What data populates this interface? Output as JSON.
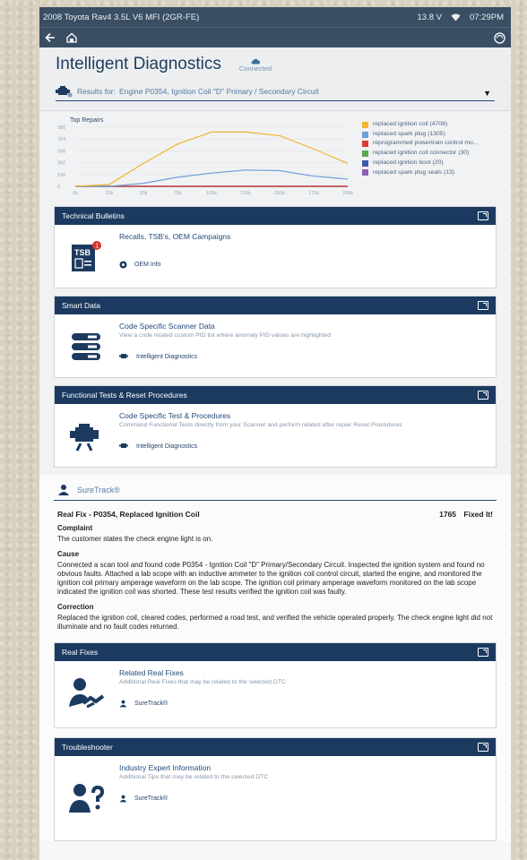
{
  "statusbar": {
    "vehicle": "2008 Toyota Rav4 3.5L V6 MFI (2GR-FE)",
    "voltage": "13.8 V",
    "time": "07:29PM"
  },
  "header": {
    "title": "Intelligent Diagnostics",
    "connection": "Connected",
    "results_prefix": "Results for:",
    "results_value": "Engine P0354, Ignition Coil \"D\" Primary / Secondary Circuit"
  },
  "chart_data": {
    "type": "line",
    "title": "Top Repairs",
    "x": [
      "0k",
      "25k",
      "50k",
      "75k",
      "100k",
      "125k",
      "150k",
      "175k",
      "200k"
    ],
    "y_ticks": [
      "980",
      "784",
      "588",
      "392",
      "196",
      "0"
    ],
    "ylim": [
      0,
      980
    ],
    "series": [
      {
        "name": "replaced ignition coil (4708)",
        "color": "#f2b431",
        "values": [
          0,
          30,
          380,
          700,
          900,
          900,
          840,
          620,
          380
        ]
      },
      {
        "name": "replaced spark plug (1305)",
        "color": "#6f9fd8",
        "values": [
          0,
          0,
          50,
          150,
          220,
          270,
          260,
          170,
          120
        ]
      },
      {
        "name": "reprogrammed powertrain control mo...",
        "color": "#d93a34",
        "values": [
          0,
          0,
          0,
          0,
          0,
          0,
          0,
          0,
          0
        ]
      },
      {
        "name": "replaced ignition coil connector (30)",
        "color": "#5aa651",
        "values": [
          0,
          0,
          0,
          0,
          0,
          0,
          0,
          0,
          0
        ]
      },
      {
        "name": "replaced ignition boot (20)",
        "color": "#3d57b0",
        "values": [
          0,
          0,
          0,
          0,
          0,
          0,
          0,
          0,
          0
        ]
      },
      {
        "name": "replaced spark plug seals (13)",
        "color": "#8e5fb4",
        "values": [
          0,
          0,
          0,
          0,
          0,
          0,
          0,
          0,
          0
        ]
      }
    ]
  },
  "bulletins": {
    "head": "Technical Bulletins",
    "badge": "1",
    "tsb": "TSB",
    "title": "Recalls, TSB's, OEM Campaigns",
    "link": "OEM Info"
  },
  "smart_data": {
    "head": "Smart Data",
    "title": "Code Specific Scanner Data",
    "desc": "View a code related custom PID list where anomaly PID values are highlighted",
    "link": "Intelligent Diagnostics"
  },
  "functional": {
    "head": "Functional Tests & Reset Procedures",
    "title": "Code Specific Test & Procedures",
    "desc": "Command Functional Tests directly from your Scanner and perform related after repair Reset Procedures",
    "link": "Intelligent Diagnostics"
  },
  "suretrack": {
    "label": "SureTrack®",
    "fix_title": "Real Fix - P0354, Replaced Ignition Coil",
    "fixed_count": "1765",
    "fixed_label": "Fixed It!",
    "complaint_h": "Complaint",
    "complaint": "The customer states the check engine light is on.",
    "cause_h": "Cause",
    "cause": "Connected a scan tool and found code P0354 - Ignition Coil \"D\" Primary/Secondary Circuit. Inspected the ignition system and found no obvious faults. Attached a lab scope with an inductive ammeter to the ignition coil control circuit, started the engine, and monitored the ignition coil primary amperage waveform on the lab scope. The ignition coil primary amperage waveform monitored on the lab scope indicated the ignition coil was shorted. These test results verified the ignition coil was faulty.",
    "correction_h": "Correction",
    "correction": "Replaced the ignition coil, cleared codes, performed a road test, and verified the vehicle operated properly. The check engine light did not illuminate and no fault codes returned."
  },
  "real_fixes": {
    "head": "Real Fixes",
    "title": "Related Real Fixes",
    "desc": "Additional Real Fixes that may be related to the selected DTC",
    "link": "SureTrack®"
  },
  "troubleshooter": {
    "head": "Troubleshooter",
    "title": "Industry Expert Information",
    "desc": "Additional Tips that may be related to the selected DTC",
    "link": "SureTrack®"
  }
}
